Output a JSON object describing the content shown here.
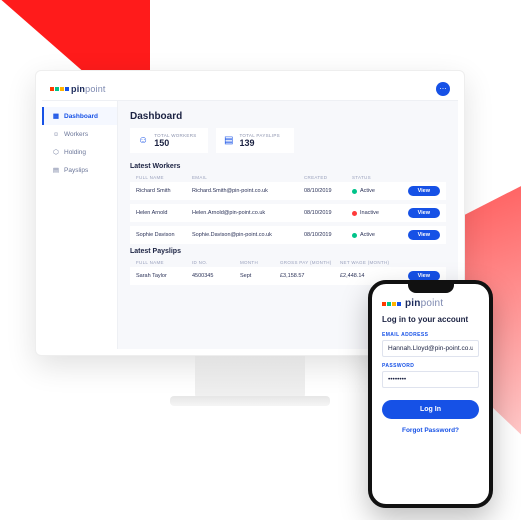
{
  "brand": {
    "strong": "pin",
    "light": "point"
  },
  "desktop": {
    "nav": {
      "items": [
        {
          "label": "Dashboard"
        },
        {
          "label": "Workers"
        },
        {
          "label": "Holding"
        },
        {
          "label": "Payslips"
        }
      ]
    },
    "page_title": "Dashboard",
    "stats": {
      "workers": {
        "label": "TOTAL WORKERS",
        "value": "150"
      },
      "payslips": {
        "label": "TOTAL PAYSLIPS",
        "value": "139"
      }
    },
    "workers_section": {
      "title": "Latest Workers",
      "head": {
        "name": "FULL NAME",
        "email": "EMAIL",
        "created": "CREATED",
        "status": "STATUS"
      },
      "rows": [
        {
          "name": "Richard Smith",
          "email": "Richard.Smith@pin-point.co.uk",
          "created": "08/10/2019",
          "status": "Active",
          "active": true
        },
        {
          "name": "Helen Arnold",
          "email": "Helen.Arnold@pin-point.co.uk",
          "created": "08/10/2019",
          "status": "Inactive",
          "active": false
        },
        {
          "name": "Sophie Davison",
          "email": "Sophie.Davison@pin-point.co.uk",
          "created": "08/10/2019",
          "status": "Active",
          "active": true
        }
      ],
      "view_label": "View"
    },
    "payslips_section": {
      "title": "Latest Payslips",
      "head": {
        "name": "FULL NAME",
        "id": "ID NO.",
        "month": "MONTH",
        "gross": "GROSS PAY (MONTH)",
        "net": "NET WAGE (MONTH)"
      },
      "rows": [
        {
          "name": "Sarah Taylor",
          "id": "4500345",
          "month": "Sept",
          "gross": "£3,158.57",
          "net": "£2,448.14"
        }
      ],
      "view_label": "View"
    }
  },
  "mobile": {
    "title": "Log in to your account",
    "email_label": "EMAIL ADDRESS",
    "password_label": "PASSWORD",
    "email_value": "Hannah.Lloyd@pin-point.co.uk",
    "password_value": "••••••••",
    "login_button": "Log In",
    "forgot": "Forgot Password?"
  }
}
